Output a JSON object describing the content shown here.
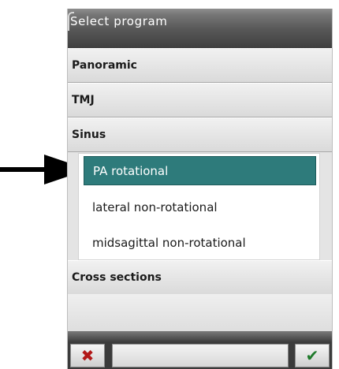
{
  "dialog": {
    "title": "Select program"
  },
  "programs": [
    {
      "label": "Panoramic"
    },
    {
      "label": "TMJ"
    },
    {
      "label": "Sinus"
    },
    {
      "label": "Cross sections"
    }
  ],
  "sinus_options": [
    {
      "label": "PA rotational",
      "selected": true
    },
    {
      "label": "lateral non-rotational",
      "selected": false
    },
    {
      "label": "midsagittal non-rotational",
      "selected": false
    }
  ],
  "footer": {
    "cancel_icon": "close-icon",
    "cancel_symbol": "✖",
    "confirm_icon": "checkmark-icon",
    "confirm_symbol": "✔",
    "status_text": ""
  },
  "colors": {
    "selection": "#2e7b7b",
    "cancel": "#b21818",
    "confirm": "#1e7a2a"
  }
}
